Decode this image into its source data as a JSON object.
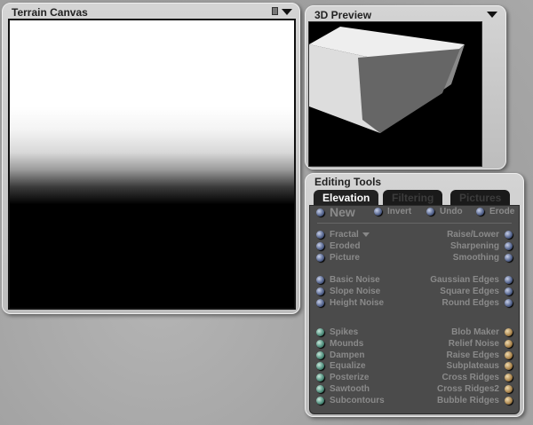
{
  "terrain_canvas": {
    "title": "Terrain Canvas",
    "icons": [
      "resize-icon",
      "menu-triangle-icon"
    ]
  },
  "preview": {
    "title": "3D Preview"
  },
  "editing_tools": {
    "title": "Editing Tools",
    "tabs": [
      {
        "label": "Elevation",
        "active": true
      },
      {
        "label": "Filtering"
      },
      {
        "label": "Pictures"
      }
    ],
    "top_row": [
      "New",
      "Invert",
      "Undo",
      "Erode"
    ],
    "left_group1": [
      "Fractal",
      "Eroded",
      "Picture"
    ],
    "right_group1": [
      "Raise/Lower",
      "Sharpening",
      "Smoothing"
    ],
    "left_group2": [
      "Basic Noise",
      "Slope Noise",
      "Height Noise"
    ],
    "right_group2": [
      "Gaussian Edges",
      "Square Edges",
      "Round Edges"
    ],
    "left_group3": [
      "Spikes",
      "Mounds",
      "Dampen",
      "Equalize",
      "Posterize",
      "Sawtooth",
      "Subcontours"
    ],
    "right_group3": [
      "Blob Maker",
      "Relief Noise",
      "Raise Edges",
      "Subplateaus",
      "Cross Ridges",
      "Cross Ridges2",
      "Bubble Ridges"
    ],
    "colors": {
      "blue": "#50608a",
      "green": "#4a8a78",
      "orange": "#a8824a"
    }
  }
}
